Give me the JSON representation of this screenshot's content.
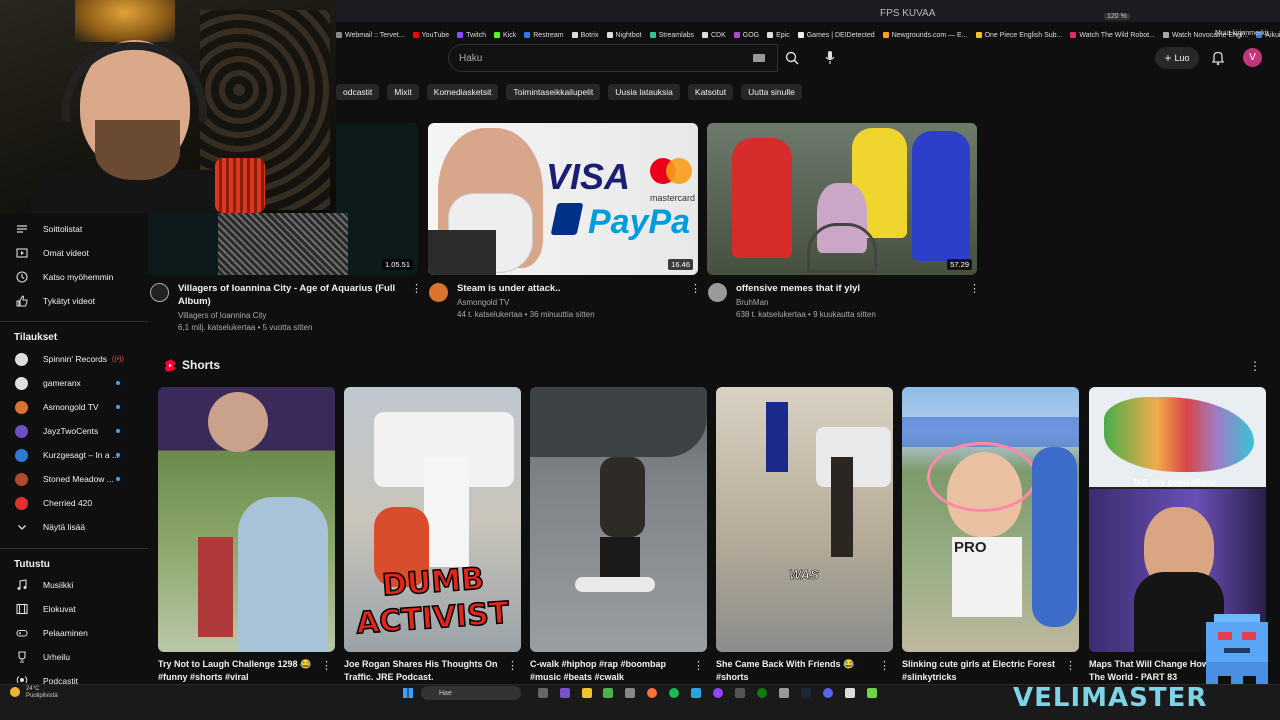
{
  "window": {
    "title": "FPS KUVAA",
    "zoom": "120 %"
  },
  "bookmarks": [
    {
      "label": "Webmail :: Tervet...",
      "color": "#888"
    },
    {
      "label": "YouTube",
      "color": "#ff0000"
    },
    {
      "label": "Twitch",
      "color": "#9146ff"
    },
    {
      "label": "Kick",
      "color": "#53fc18"
    },
    {
      "label": "Restream",
      "color": "#2c7be5"
    },
    {
      "label": "Botrix",
      "color": "#ddd"
    },
    {
      "label": "Nightbot",
      "color": "#ddd"
    },
    {
      "label": "Streamlabs",
      "color": "#31c3a2"
    },
    {
      "label": "CDK",
      "color": "#ddd"
    },
    {
      "label": "GOG",
      "color": "#a64dc7"
    },
    {
      "label": "Epic",
      "color": "#ddd"
    },
    {
      "label": "Games | DEIDetected",
      "color": "#eee"
    },
    {
      "label": "Newgrounds.com — E...",
      "color": "#f6a21a"
    },
    {
      "label": "One Piece English Sub...",
      "color": "#f3c623"
    },
    {
      "label": "Watch The Wild Robot...",
      "color": "#e22b6a"
    },
    {
      "label": "Watch Novocaine Engl...",
      "color": "#aaa"
    },
    {
      "label": "Aikuisten sosiaalipalve...",
      "color": "#3a7bd5"
    }
  ],
  "bookmarks_other": "Muut kirjanmerkit",
  "search": {
    "placeholder": "Haku"
  },
  "header": {
    "create_label": "Luo",
    "avatar_letter": "V"
  },
  "chips": [
    "odcastit",
    "Mixit",
    "Komediasketsit",
    "Toimintaseikkailupelit",
    "Uusia latauksia",
    "Katsotut",
    "Uutta sinulle"
  ],
  "sidebar": {
    "library": [
      {
        "label": "Soittolistat",
        "icon": "playlist-icon"
      },
      {
        "label": "Omat videot",
        "icon": "video-icon"
      },
      {
        "label": "Katso myöhemmin",
        "icon": "clock-icon"
      },
      {
        "label": "Tykätyt videot",
        "icon": "thumbs-up-icon"
      }
    ],
    "subs_heading": "Tilaukset",
    "subscriptions": [
      {
        "label": "Spinnin' Records",
        "color": "#ddd",
        "badge": "live-red"
      },
      {
        "label": "gameranx",
        "color": "#e0e0e0",
        "badge": "dot"
      },
      {
        "label": "Asmongold TV",
        "color": "#d9732f",
        "badge": "dot"
      },
      {
        "label": "JayzTwoCents",
        "color": "#6b4fc5",
        "badge": "dot"
      },
      {
        "label": "Kurzgesagt – In a ...",
        "color": "#2f7ad6",
        "badge": "dot"
      },
      {
        "label": "Stoned Meadow ...",
        "color": "#b24a2a",
        "badge": "dot"
      },
      {
        "label": "Cherried 420",
        "color": "#e23030",
        "badge": ""
      }
    ],
    "show_more": "Näytä lisää",
    "explore_heading": "Tutustu",
    "explore": [
      {
        "label": "Musiikki",
        "icon": "music-icon"
      },
      {
        "label": "Elokuvat",
        "icon": "film-icon"
      },
      {
        "label": "Pelaaminen",
        "icon": "gamepad-icon"
      },
      {
        "label": "Urheilu",
        "icon": "trophy-icon"
      },
      {
        "label": "Podcastit",
        "icon": "podcast-icon"
      }
    ]
  },
  "videos": [
    {
      "title": "Villagers of Ioannina City - Age of Aquarius (Full Album)",
      "channel": "Villagers of Ioannina City",
      "stats": "6,1 milj. katselukertaa • 5 vuotta sitten",
      "duration": "1.05.51"
    },
    {
      "title": "Steam is under attack..",
      "channel": "Asmongold TV",
      "stats": "44 t. katselukertaa • 36 minuuttia sitten",
      "duration": "16.46"
    },
    {
      "title": "offensive memes that if ylyl",
      "channel": "BruhMan",
      "stats": "638 t. katselukertaa • 9 kuukautta sitten",
      "duration": "57.29"
    }
  ],
  "thumb_text": {
    "visa": "VISA",
    "mastercard": "mastercard",
    "paypal": "PayPa"
  },
  "shorts": {
    "heading": "Shorts",
    "items": [
      {
        "title": "Try Not to Laugh Challenge 1298 😂 #funny #shorts #viral"
      },
      {
        "title": "Joe Rogan Shares His Thoughts On Traffic. JRE Podcast."
      },
      {
        "title": "C-walk #hiphop #rap #boombap #music #beats #cwalk"
      },
      {
        "title": "She Came Back With Friends 😂 #shorts"
      },
      {
        "title": "Slinking cute girls at Electric Forest #slinkytricks"
      },
      {
        "title": "Maps That Will Change How You See The World - PART 83"
      }
    ],
    "overlay_dumb": "DUMB",
    "overlay_activist": "ACTIVIST",
    "overlay_was": "WAS",
    "overlay_pro": "PRO",
    "overlay_map": "U.S city populations"
  },
  "taskbar": {
    "search": "Hae",
    "weather_temp": "24°C",
    "weather_desc": "Puolipilvistä"
  },
  "overlay": {
    "brand": "VELIMASTER"
  }
}
